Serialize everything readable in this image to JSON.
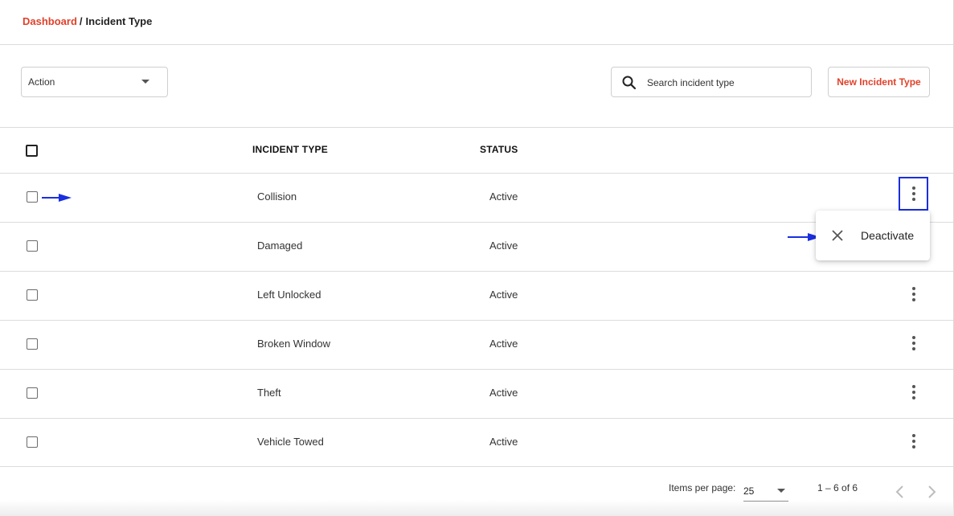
{
  "breadcrumb": {
    "parent": "Dashboard",
    "separator": "/",
    "current": "Incident Type"
  },
  "toolbar": {
    "action_label": "Action",
    "search_placeholder": "Search incident type",
    "new_button_label": "New Incident Type"
  },
  "table": {
    "columns": [
      "INCIDENT TYPE",
      "STATUS"
    ],
    "rows": [
      {
        "incident_type": "Collision",
        "status": "Active"
      },
      {
        "incident_type": "Damaged",
        "status": "Active"
      },
      {
        "incident_type": "Left Unlocked",
        "status": "Active"
      },
      {
        "incident_type": "Broken Window",
        "status": "Active"
      },
      {
        "incident_type": "Theft",
        "status": "Active"
      },
      {
        "incident_type": "Vehicle Towed",
        "status": "Active"
      }
    ]
  },
  "row_menu": {
    "items": [
      {
        "label": "Deactivate",
        "icon": "close-icon"
      }
    ]
  },
  "pagination": {
    "items_per_page_label": "Items per page:",
    "items_per_page_value": "25",
    "range_label": "1 – 6 of 6"
  },
  "colors": {
    "accent": "#e0412a",
    "annotation": "#1a2fe0"
  }
}
